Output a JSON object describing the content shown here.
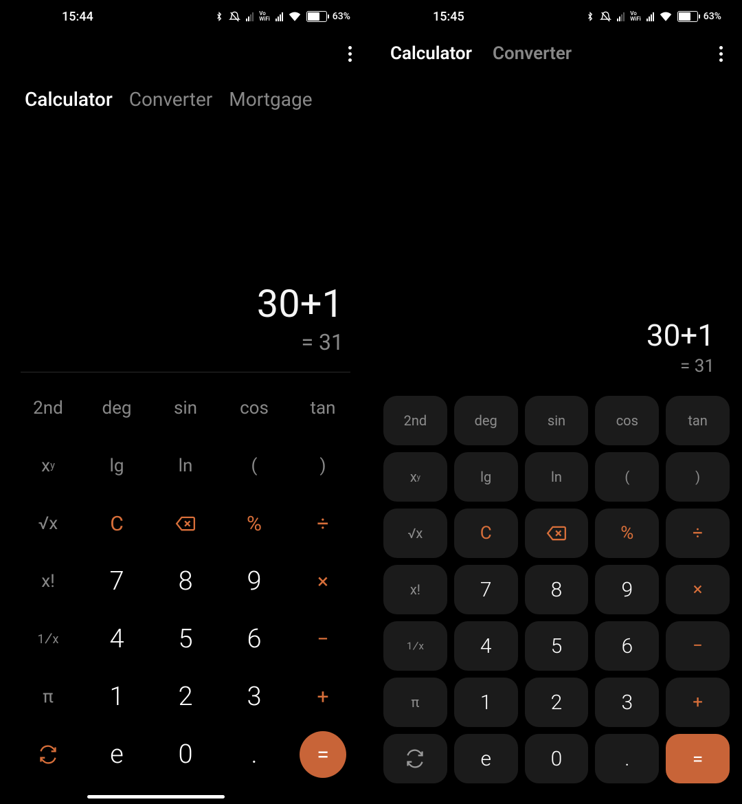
{
  "left": {
    "status": {
      "time": "15:44",
      "battery_pct": "63%",
      "vowifi": "Vo\nWiFi"
    },
    "tabs": [
      "Calculator",
      "Converter",
      "Mortgage"
    ],
    "active_tab_index": 0,
    "expression": "30+1",
    "result": "= 31",
    "keys": {
      "r0": [
        "2nd",
        "deg",
        "sin",
        "cos",
        "tan"
      ],
      "r1": [
        "xʸ",
        "lg",
        "ln",
        "(",
        ")"
      ],
      "r2": [
        "√x",
        "C",
        "⌫",
        "%",
        "÷"
      ],
      "r3": [
        "x!",
        "7",
        "8",
        "9",
        "×"
      ],
      "r4": [
        "¹⁄ₓ",
        "4",
        "5",
        "6",
        "−"
      ],
      "r5": [
        "π",
        "1",
        "2",
        "3",
        "+"
      ],
      "r6": [
        "↻",
        "e",
        "0",
        ".",
        "="
      ]
    }
  },
  "right": {
    "status": {
      "time": "15:45",
      "battery_pct": "63%",
      "vowifi": "Vo\nWiFi"
    },
    "tabs": [
      "Calculator",
      "Converter"
    ],
    "active_tab_index": 0,
    "expression": "30+1",
    "result": "= 31",
    "keys": {
      "r0": [
        "2nd",
        "deg",
        "sin",
        "cos",
        "tan"
      ],
      "r1": [
        "xʸ",
        "lg",
        "ln",
        "(",
        ")"
      ],
      "r2": [
        "√x",
        "C",
        "⌫",
        "%",
        "÷"
      ],
      "r3": [
        "x!",
        "7",
        "8",
        "9",
        "×"
      ],
      "r4": [
        "¹⁄ₓ",
        "4",
        "5",
        "6",
        "−"
      ],
      "r5": [
        "π",
        "1",
        "2",
        "3",
        "+"
      ],
      "r6": [
        "↻",
        "e",
        "0",
        ".",
        "="
      ]
    }
  }
}
